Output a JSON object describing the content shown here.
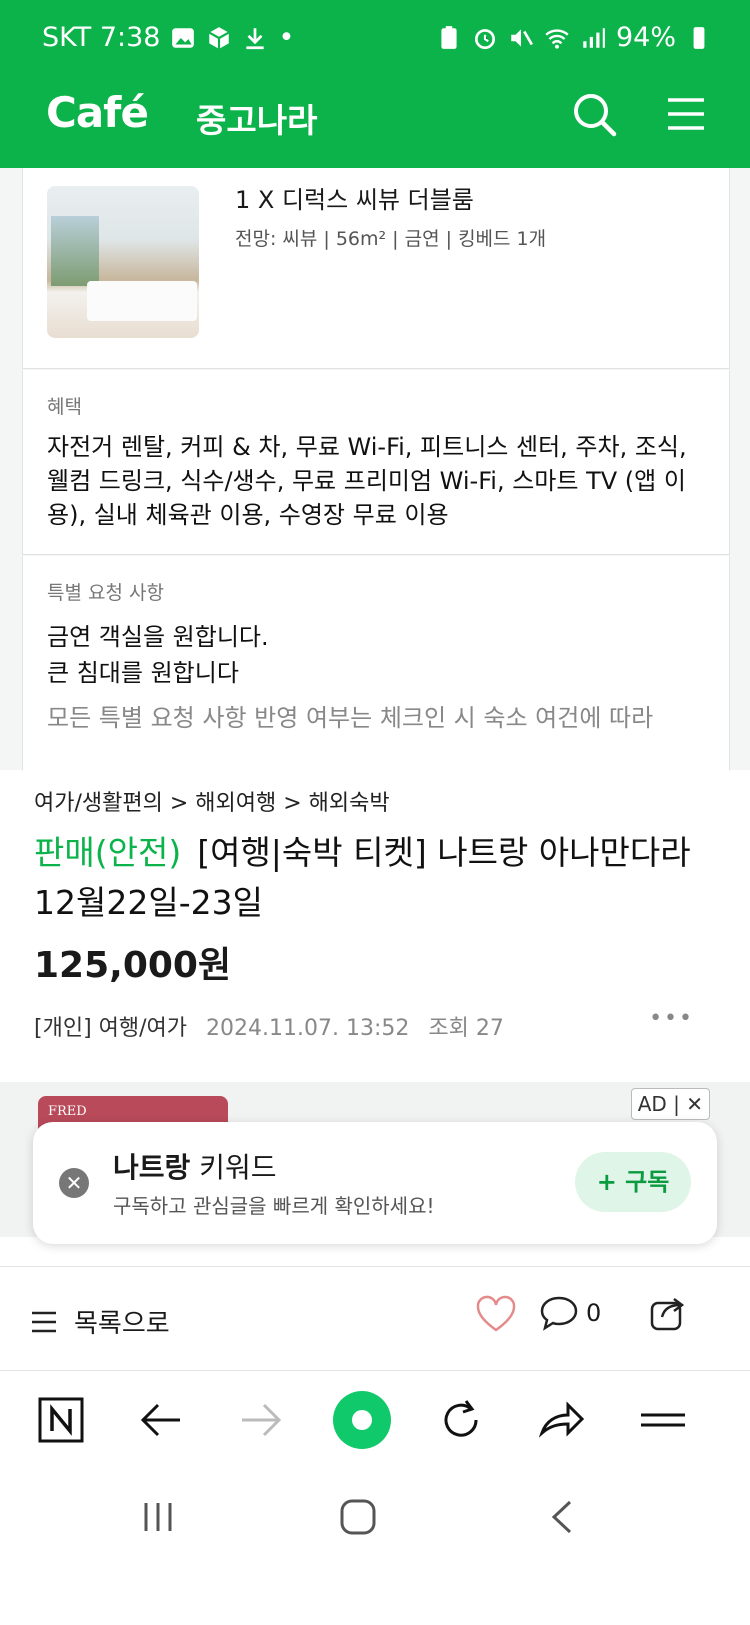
{
  "status_bar": {
    "carrier_time": "SKT 7:38",
    "dot": "•",
    "battery": "94%"
  },
  "header": {
    "logo": "Café",
    "cafe_name": "중고나라"
  },
  "embedded": {
    "room_title": "1 X 디럭스 씨뷰 더블룸",
    "room_sub": "전망: 씨뷰 | 56m² | 금연 | 킹베드 1개",
    "benefit_label": "혜택",
    "benefit_text": "자전거 렌탈, 커피 & 차, 무료 Wi-Fi, 피트니스 센터, 주차, 조식, 웰컴 드링크, 식수/생수, 무료 프리미엄 Wi-Fi, 스마트 TV (앱 이용), 실내 체육관 이용, 수영장 무료 이용",
    "request_label": "특별 요청 사항",
    "request_line1": "금연 객실을 원합니다.",
    "request_line2": "큰 침대를 원합니다",
    "request_note": "모든 특별 요청 사항 반영 여부는 체크인 시 숙소 여건에 따라"
  },
  "article": {
    "breadcrumb": "여가/생활편의 > 해외여행 > 해외숙박",
    "badge": "판매(안전)",
    "title": "[여행|숙박 티켓] 나트랑 아나만다라 12월22일-23일",
    "price": "125,000원",
    "seller_type": "[개인] 여행/여가",
    "date": "2024.11.07. 13:52",
    "views": "조회 27",
    "more": "•••"
  },
  "ad": {
    "brand": "FRED",
    "badge": "AD",
    "close": "✕"
  },
  "keyword_popup": {
    "keyword": "나트랑",
    "suffix": " 키워드",
    "subtitle": "구독하고 관심글을 빠르게 확인하세요!",
    "subscribe": "+ 구독",
    "close": "✕"
  },
  "actions": {
    "list_label": "목록으로",
    "comment_count": "0"
  },
  "colors": {
    "brand_green": "#0bb34a",
    "home_green": "#10c96a"
  }
}
